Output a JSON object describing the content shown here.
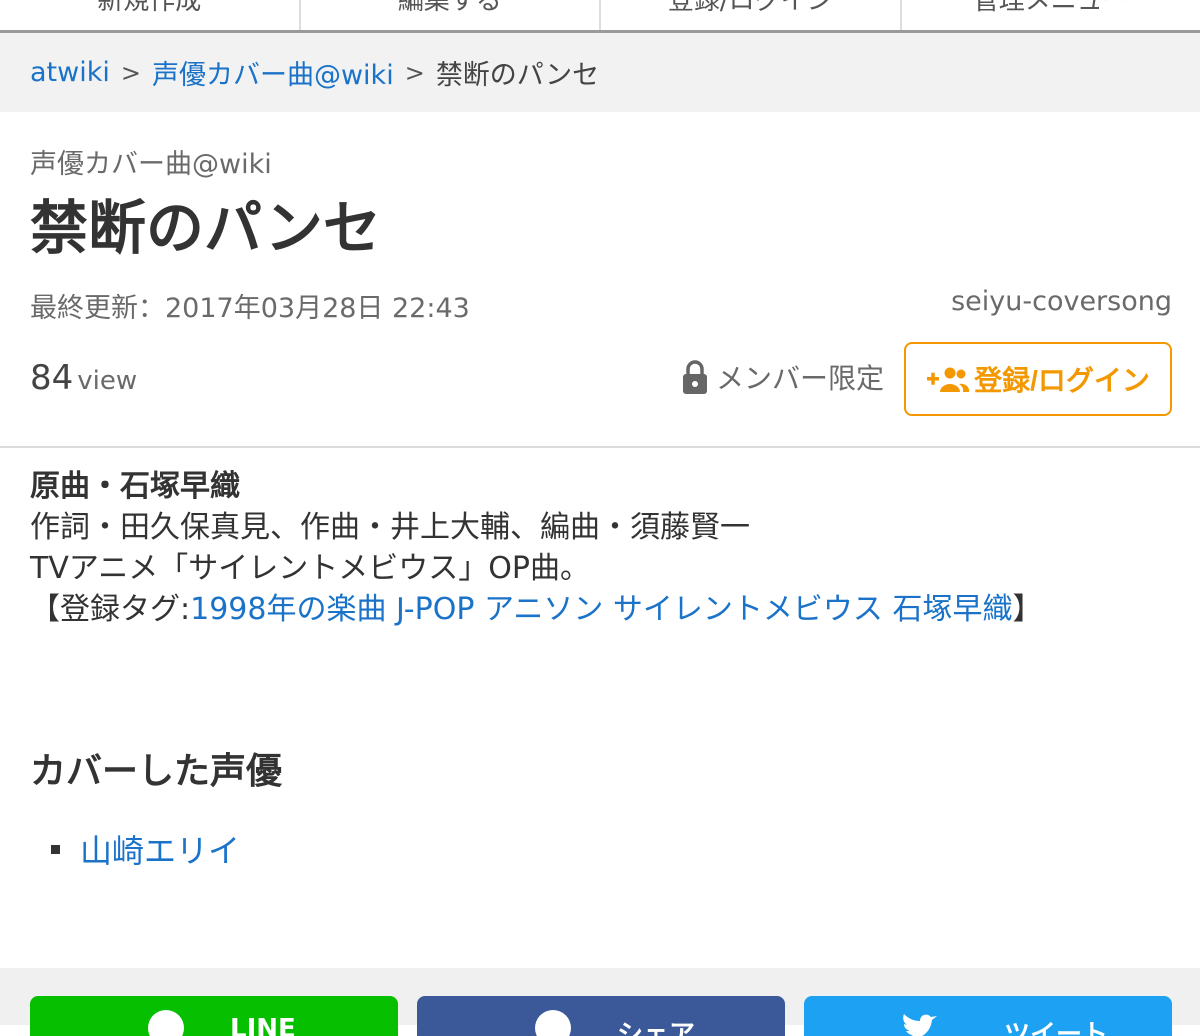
{
  "top_tabs": [
    {
      "label": "新規作成"
    },
    {
      "label": "編集する"
    },
    {
      "label": "登録/ログイン"
    },
    {
      "label": "管理メニュー"
    }
  ],
  "breadcrumb": {
    "root": "atwiki",
    "separator": ">",
    "wiki": "声優カバー曲@wiki",
    "current": "禁断のパンセ"
  },
  "header": {
    "site_name": "声優カバー曲@wiki",
    "title": "禁断のパンセ",
    "last_updated": "最終更新：2017年03月28日 22:43",
    "owner": "seiyu-coversong",
    "view_count": "84",
    "view_unit": "view",
    "member_only": "メンバー限定",
    "login_label": "登録/ログイン"
  },
  "content": {
    "original": "原曲・石塚早織",
    "credits": "作詞・田久保真見、作曲・井上大輔、編曲・須藤賢一",
    "description": "TVアニメ「サイレントメビウス」OP曲。",
    "tags_prefix": "【登録タグ:",
    "tags": [
      "1998年の楽曲",
      "J-POP",
      "アニソン",
      "サイレントメビウス",
      "石塚早織"
    ],
    "tags_suffix": "】"
  },
  "cover_section": {
    "title": "カバーした声優",
    "items": [
      "山崎エリイ"
    ]
  },
  "share": {
    "line": "LINE",
    "facebook": "シェア",
    "twitter": "ツイート"
  },
  "colors": {
    "link": "#1a73c8",
    "accent": "#f39800",
    "line": "#06c000",
    "facebook": "#3b5998",
    "twitter": "#1da1f2"
  },
  "icons": {
    "member": "lock-icon",
    "login": "user-plus-icon"
  }
}
